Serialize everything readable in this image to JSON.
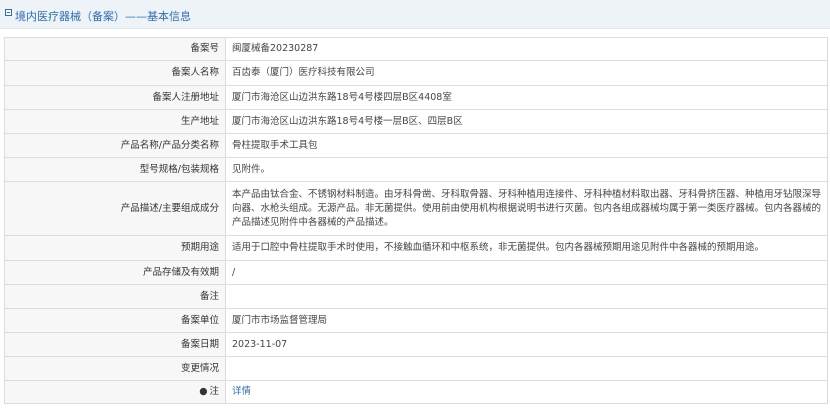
{
  "header": {
    "title": "境内医疗器械（备案）——基本信息"
  },
  "rows": [
    {
      "label": "备案号",
      "value": "闽厦械备20230287"
    },
    {
      "label": "备案人名称",
      "value": "百齿泰（厦门）医疗科技有限公司"
    },
    {
      "label": "备案人注册地址",
      "value": "厦门市海沧区山边洪东路18号4号楼四层B区4408室"
    },
    {
      "label": "生产地址",
      "value": "厦门市海沧区山边洪东路18号4号楼一层B区、四层B区"
    },
    {
      "label": "产品名称/产品分类名称",
      "value": "骨柱提取手术工具包"
    },
    {
      "label": "型号规格/包装规格",
      "value": "见附件。"
    },
    {
      "label": "产品描述/主要组成成分",
      "value": "本产品由钛合金、不锈钢材料制造。由牙科骨凿、牙科取骨器、牙科种植用连接件、牙科种植材料取出器、牙科骨挤压器、种植用牙钻限深导向器、水枪头组成。无源产品。非无菌提供。使用前由使用机构根据说明书进行灭菌。包内各组成器械均属于第一类医疗器械。包内各器械的产品描述见附件中各器械的产品描述。"
    },
    {
      "label": "预期用途",
      "value": "适用于口腔中骨柱提取手术时使用，不接触血循环和中枢系统，非无菌提供。包内各器械预期用途见附件中各器械的预期用途。"
    },
    {
      "label": "产品存储及有效期",
      "value": "/"
    },
    {
      "label": "备注",
      "value": ""
    },
    {
      "label": "备案单位",
      "value": "厦门市市场监督管理局"
    },
    {
      "label": "备案日期",
      "value": "2023-11-07"
    },
    {
      "label": "变更情况",
      "value": ""
    },
    {
      "label": "注",
      "value": "详情",
      "icon": "info-marker-icon",
      "icon_glyph": "●"
    }
  ],
  "colors": {
    "accent": "#2e6eb5",
    "label_bg": "#f7f7f7",
    "border": "#dcdcdc",
    "header_bg": "#eef3f8"
  }
}
